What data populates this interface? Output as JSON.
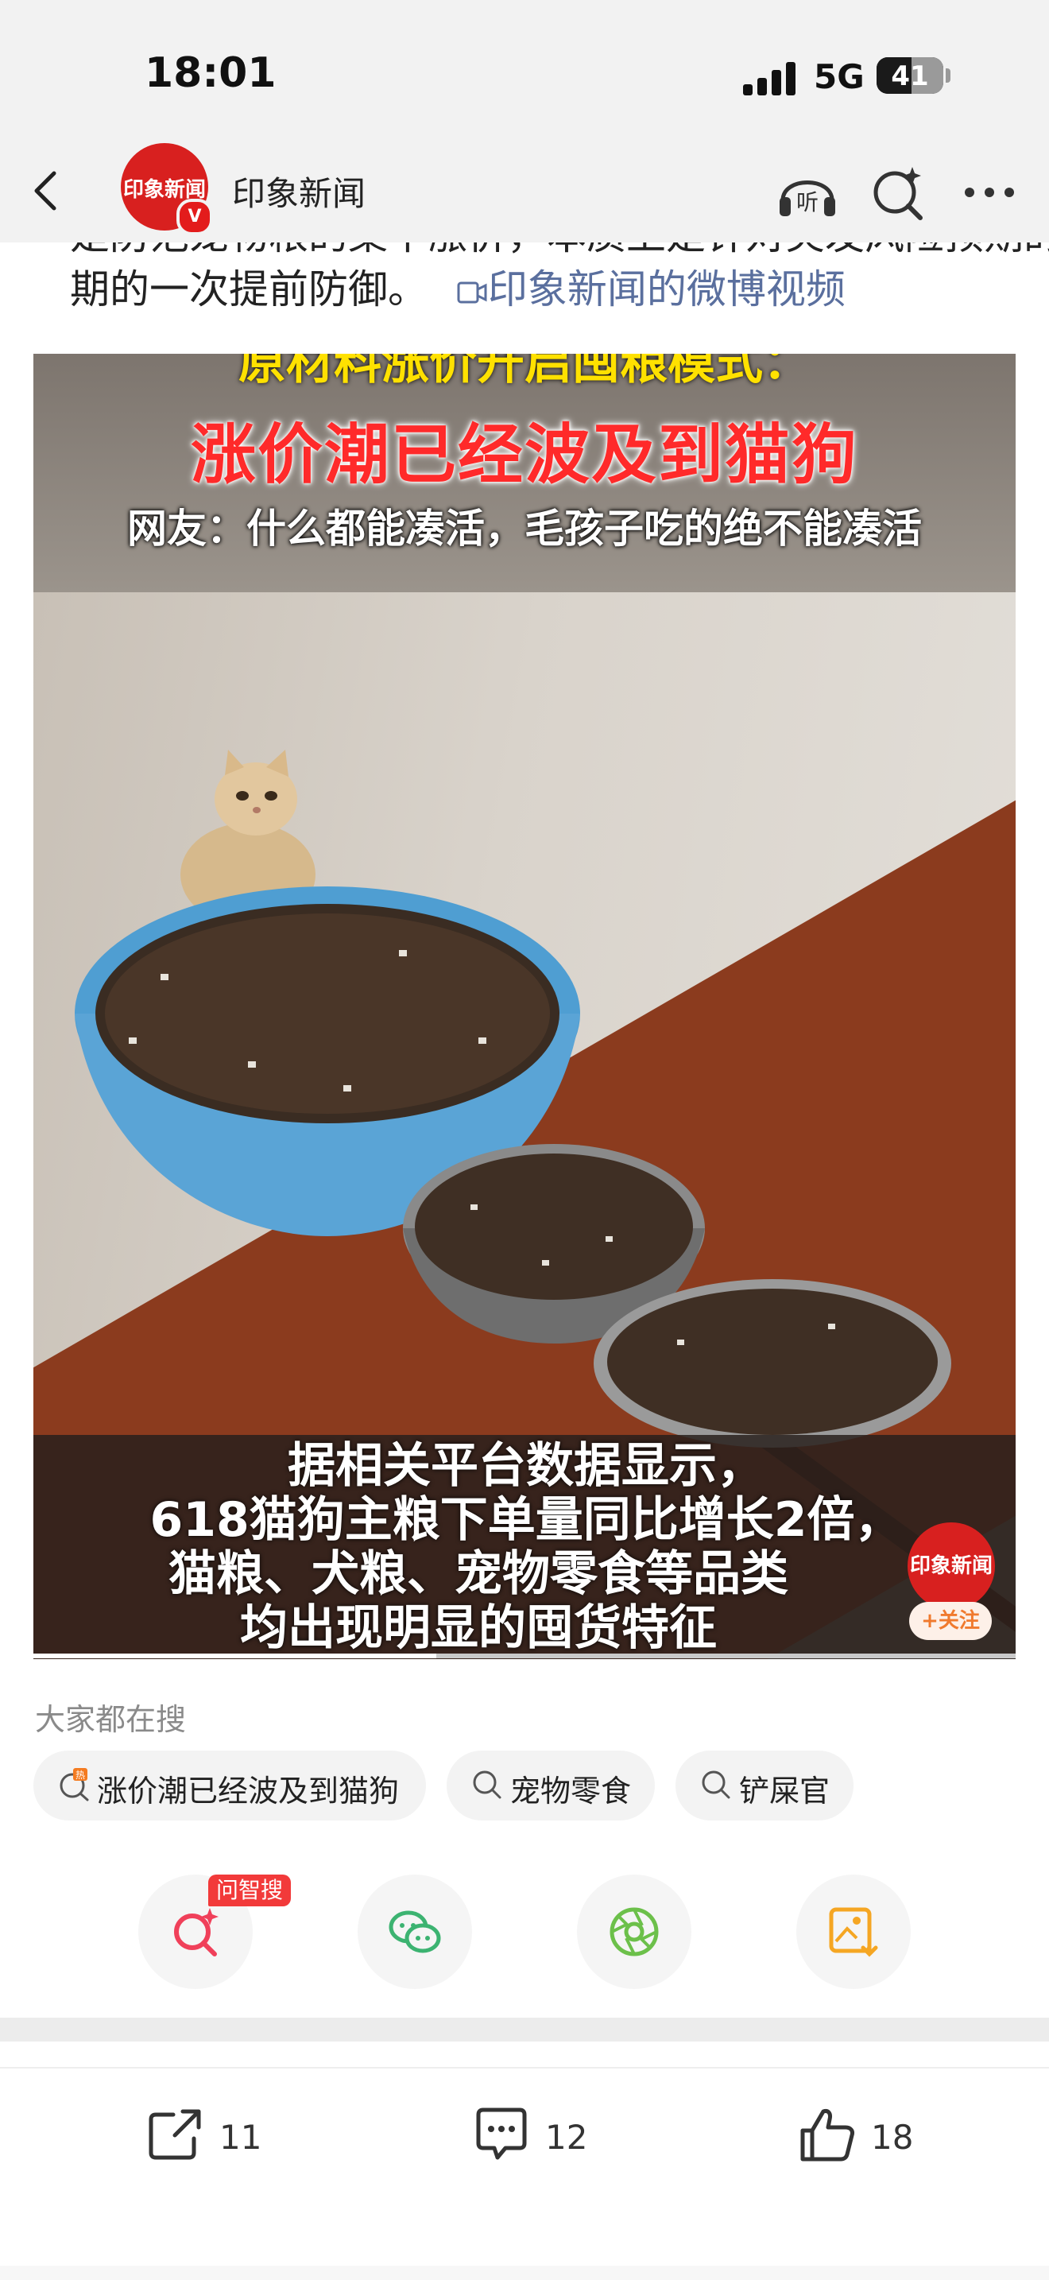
{
  "status_bar": {
    "time": "18:01",
    "network": "5G",
    "battery": "41"
  },
  "nav": {
    "account_name": "印象新闻",
    "avatar_text": "印象新闻",
    "verified_badge": "V"
  },
  "post": {
    "partial_line": "是防范宠物粮的集中涨价，本质上是针对突发风险预期的一次提前防御。",
    "line2_text": "期的一次提前防御。",
    "video_link": "印象新闻的微博视频"
  },
  "video": {
    "top_title": "原材料涨价开启囤粮模式：",
    "headline": "涨价潮已经波及到猫狗",
    "subline": "网友：什么都能凑活，毛孩子吃的绝不能凑活",
    "captions": [
      "据相关平台数据显示，",
      "618猫狗主粮下单量同比增长2倍，",
      "猫粮、犬粮、宠物零食等品类",
      "均出现明显的囤货特征"
    ],
    "watermark_logo": "印象新闻",
    "watermark_follow": "+关注",
    "progress": 0.41
  },
  "search": {
    "heading": "大家都在搜",
    "chips": [
      {
        "label": "涨价潮已经波及到猫狗",
        "icon": "hot-search-icon"
      },
      {
        "label": "宠物零食",
        "icon": "search-icon"
      },
      {
        "label": "铲屎官",
        "icon": "search-icon"
      }
    ]
  },
  "share": {
    "ai_badge": "问智搜",
    "buttons": [
      "ai-search-icon",
      "wechat-icon",
      "moments-icon",
      "save-image-icon"
    ]
  },
  "actions": {
    "repost_count": "11",
    "comment_count": "12",
    "like_count": "18"
  },
  "colors": {
    "accent_red": "#d8201f",
    "link_blue": "#5a6f9e",
    "badge_red": "#f23a3a"
  }
}
